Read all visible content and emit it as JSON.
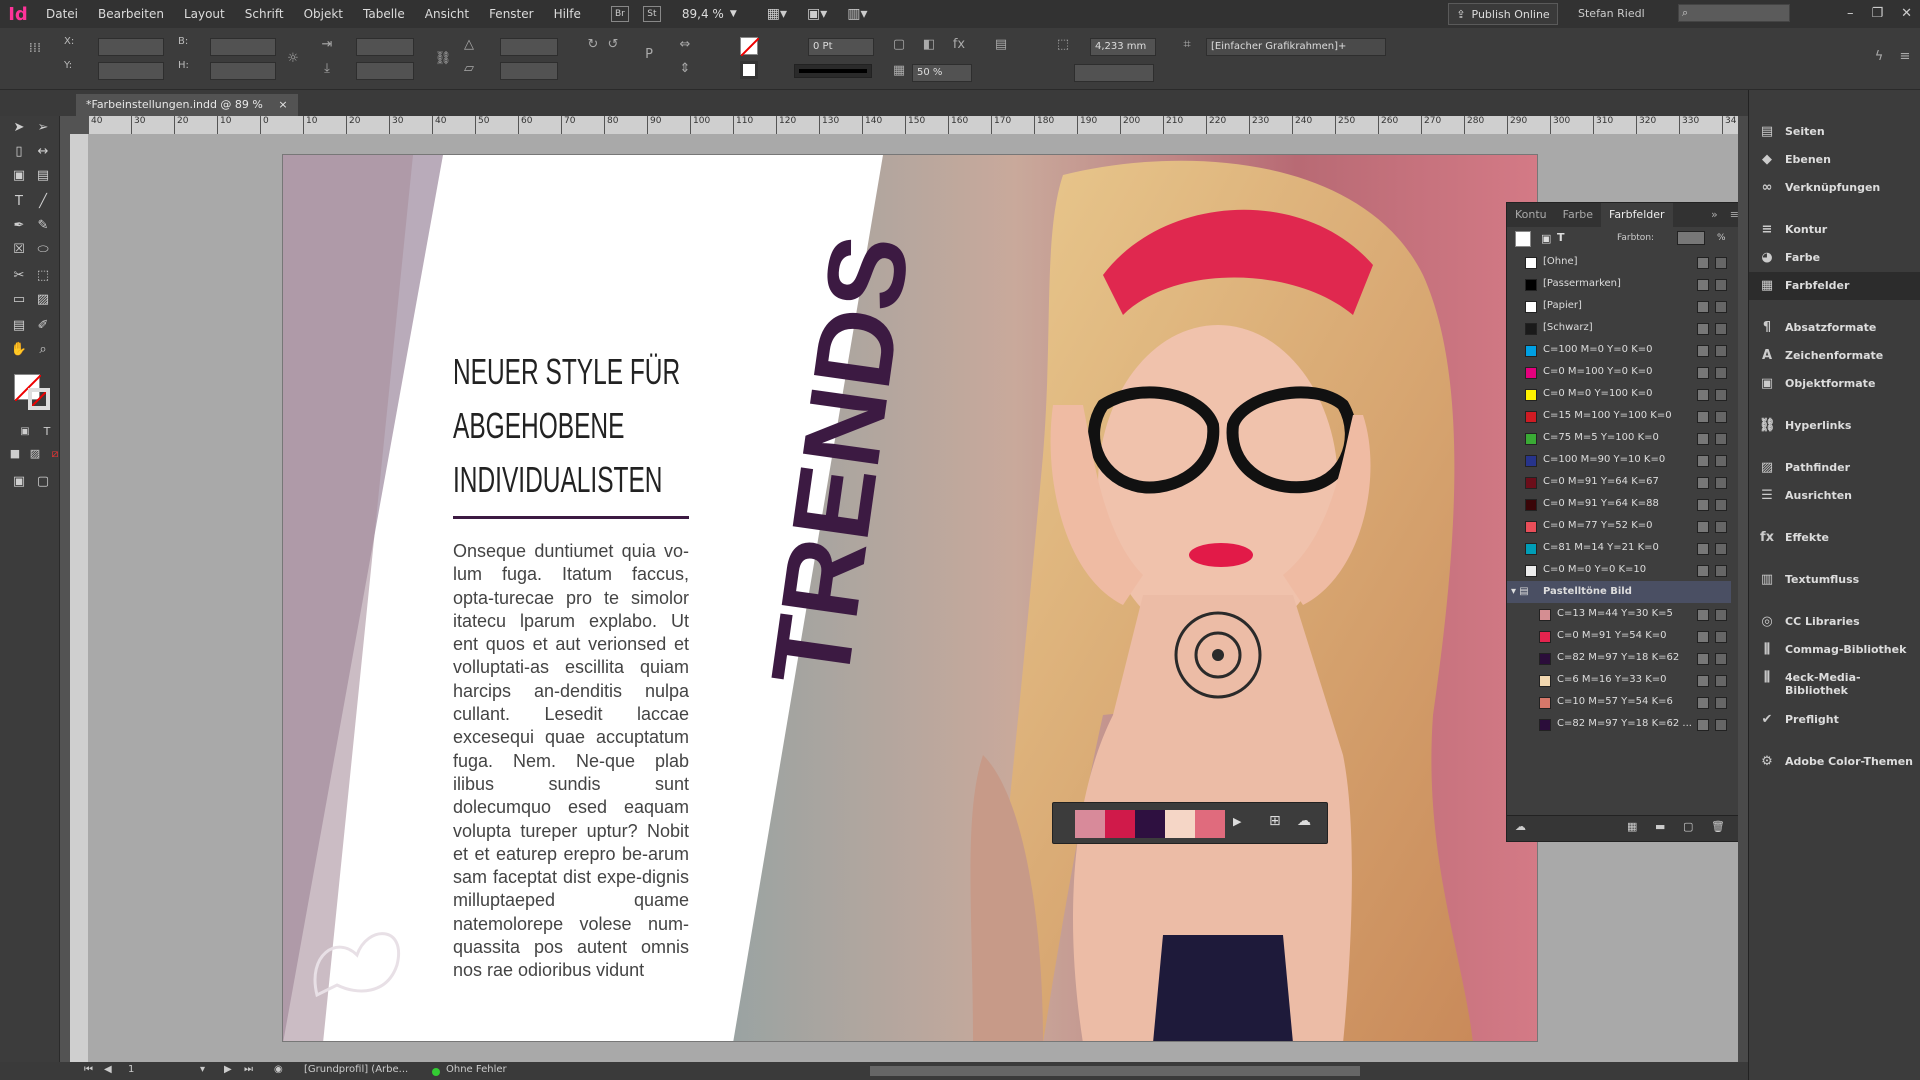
{
  "menubar": {
    "logo": "Id",
    "items": [
      "Datei",
      "Bearbeiten",
      "Layout",
      "Schrift",
      "Objekt",
      "Tabelle",
      "Ansicht",
      "Fenster",
      "Hilfe"
    ],
    "btn_br": "Br",
    "btn_st": "St",
    "zoom": "89,4 %",
    "publish": "Publish Online",
    "user": "Stefan Riedl"
  },
  "control": {
    "x_label": "X:",
    "y_label": "Y:",
    "b_label": "B:",
    "h_label": "H:",
    "stroke_pt": "0 Pt",
    "percent": "50 %",
    "mm": "4,233 mm",
    "frame_style": "[Einfacher Grafikrahmen]+"
  },
  "doc": {
    "tab_title": "*Farbeinstellungen.indd @ 89 %"
  },
  "ruler": {
    "marks": [
      "40",
      "30",
      "20",
      "10",
      "0",
      "10",
      "20",
      "30",
      "40",
      "50",
      "60",
      "70",
      "80",
      "90",
      "100",
      "110",
      "120",
      "130",
      "140",
      "150",
      "160",
      "170",
      "180",
      "190",
      "200",
      "210",
      "220",
      "230",
      "240",
      "250",
      "260",
      "270",
      "280",
      "290",
      "300",
      "310",
      "320",
      "330",
      "34"
    ]
  },
  "page": {
    "headline": [
      "NEUER STYLE FÜR",
      "ABGEHOBENE",
      "INDIVIDUALISTEN"
    ],
    "trends": "TRENDS",
    "body": "Onseque duntiumet quia vo-lum fuga. Itatum faccus, opta-turecae pro te simolor itatecu lparum explabo. Ut ent quos et aut verionsed et volluptati-as escillita quiam harcips an-denditis nulpa cullant. Lesedit laccae excesequi quae accuptatum fuga. Nem. Ne-que plab ilibus sundis sunt dolecumquo esed eaquam volupta tureper uptur? Nobit et et eaturep erepro be-arum sam faceptat dist expe-dignis milluptaeped quame natemolorepe volese num-quassita pos autent omnis nos rae odioribus vidunt"
  },
  "popup": {
    "swatches": [
      "#d88a9a",
      "#d01a4a",
      "#2e1040",
      "#f5d6c6",
      "#e06b7d"
    ]
  },
  "panel": {
    "tabs": [
      "Kontu",
      "Farbe",
      "Farbfelder"
    ],
    "farbton_label": "Farbton:",
    "farbton_unit": "%",
    "rows": [
      {
        "name": "[Ohne]",
        "color": "#ffffff"
      },
      {
        "name": "[Passermarken]",
        "color": "#000000"
      },
      {
        "name": "[Papier]",
        "color": "#ffffff"
      },
      {
        "name": "[Schwarz]",
        "color": "#1a1a1a"
      },
      {
        "name": "C=100 M=0 Y=0 K=0",
        "color": "#00a0e3"
      },
      {
        "name": "C=0 M=100 Y=0 K=0",
        "color": "#e4007d"
      },
      {
        "name": "C=0 M=0 Y=100 K=0",
        "color": "#fff200"
      },
      {
        "name": "C=15 M=100 Y=100 K=0",
        "color": "#cf1b23"
      },
      {
        "name": "C=75 M=5 Y=100 K=0",
        "color": "#3aaa35"
      },
      {
        "name": "C=100 M=90 Y=10 K=0",
        "color": "#27348b"
      },
      {
        "name": "C=0 M=91 Y=64 K=67",
        "color": "#6b0e1a"
      },
      {
        "name": "C=0 M=91 Y=64 K=88",
        "color": "#3a0508"
      },
      {
        "name": "C=0 M=77 Y=52 K=0",
        "color": "#e94e59"
      },
      {
        "name": "C=81 M=14 Y=21 K=0",
        "color": "#009db7"
      },
      {
        "name": "C=0 M=0 Y=0 K=10",
        "color": "#ececec"
      }
    ],
    "group": "Pastelltöne Bild",
    "group_rows": [
      {
        "name": "C=13 M=44 Y=30 K=5",
        "color": "#d48e92"
      },
      {
        "name": "C=0 M=91 Y=54 K=0",
        "color": "#e5244e"
      },
      {
        "name": "C=82 M=97 Y=18 K=62",
        "color": "#2b0d3a"
      },
      {
        "name": "C=6 M=16 Y=33 K=0",
        "color": "#f1d7b0"
      },
      {
        "name": "C=10 M=57 Y=54 K=6",
        "color": "#d6786a"
      },
      {
        "name": "C=82 M=97 Y=18 K=62 ...",
        "color": "#2b0d3a"
      }
    ]
  },
  "sidepanel": [
    {
      "label": "Seiten",
      "icon": "▤"
    },
    {
      "label": "Ebenen",
      "icon": "◆"
    },
    {
      "label": "Verknüpfungen",
      "icon": "∞"
    },
    {
      "label": "Kontur",
      "icon": "≡"
    },
    {
      "label": "Farbe",
      "icon": "◕"
    },
    {
      "label": "Farbfelder",
      "icon": "▦"
    },
    {
      "label": "Absatzformate",
      "icon": "¶"
    },
    {
      "label": "Zeichenformate",
      "icon": "A"
    },
    {
      "label": "Objektformate",
      "icon": "▣"
    },
    {
      "label": "Hyperlinks",
      "icon": "⛓"
    },
    {
      "label": "Pathfinder",
      "icon": "▨"
    },
    {
      "label": "Ausrichten",
      "icon": "☰"
    },
    {
      "label": "Effekte",
      "icon": "fx"
    },
    {
      "label": "Textumfluss",
      "icon": "▥"
    },
    {
      "label": "CC Libraries",
      "icon": "◎"
    },
    {
      "label": "Commag-Bibliothek",
      "icon": "⫼"
    },
    {
      "label": "4eck-Media-Bibliothek",
      "icon": "⫼"
    },
    {
      "label": "Preflight",
      "icon": "✔"
    },
    {
      "label": "Adobe Color-Themen",
      "icon": "⚙"
    }
  ],
  "status": {
    "page": "1",
    "profile": "[Grundprofil] (Arbe...",
    "errors": "Ohne Fehler"
  }
}
